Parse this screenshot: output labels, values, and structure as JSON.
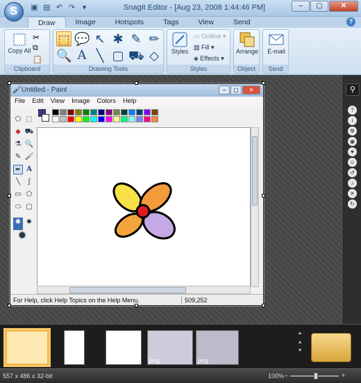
{
  "window": {
    "title": "SnagIt Editor - [Aug 23, 2008 1:44:46 PM]"
  },
  "tabs": [
    "Draw",
    "Image",
    "Hotspots",
    "Tags",
    "View",
    "Send"
  ],
  "ribbon": {
    "clipboard": {
      "copy_all": "Copy All",
      "label": "Clipboard"
    },
    "drawing_tools_label": "Drawing Tools",
    "styles": {
      "styles_btn": "Styles",
      "outline": "Outline",
      "fill": "Fill",
      "effects": "Effects",
      "label": "Styles"
    },
    "object": {
      "arrange": "Arrange",
      "label": "Object"
    },
    "send": {
      "email": "E-mail",
      "label": "Send"
    }
  },
  "paint": {
    "title": "Untitled - Paint",
    "menu": [
      "File",
      "Edit",
      "View",
      "Image",
      "Colors",
      "Help"
    ],
    "palette": [
      "#000000",
      "#808080",
      "#800000",
      "#808000",
      "#008000",
      "#008080",
      "#000080",
      "#800080",
      "#808040",
      "#004040",
      "#0080ff",
      "#004080",
      "#8000ff",
      "#804000",
      "#ffffff",
      "#c0c0c0",
      "#ff0000",
      "#ffff00",
      "#00ff00",
      "#00ffff",
      "#0000ff",
      "#ff00ff",
      "#ffff80",
      "#00ff80",
      "#80ffff",
      "#8080ff",
      "#ff0080",
      "#ff8040"
    ],
    "status_msg": "For Help, click Help Topics on the Help Menu.",
    "coords": "509,252"
  },
  "tray": {
    "items": [
      {
        "label": ""
      },
      {
        "label": ""
      },
      {
        "label": ""
      },
      {
        "label": "png"
      },
      {
        "label": "png"
      }
    ]
  },
  "statusbar": {
    "dimensions": "557 x 486 x 32-bit",
    "zoom": "100%"
  }
}
